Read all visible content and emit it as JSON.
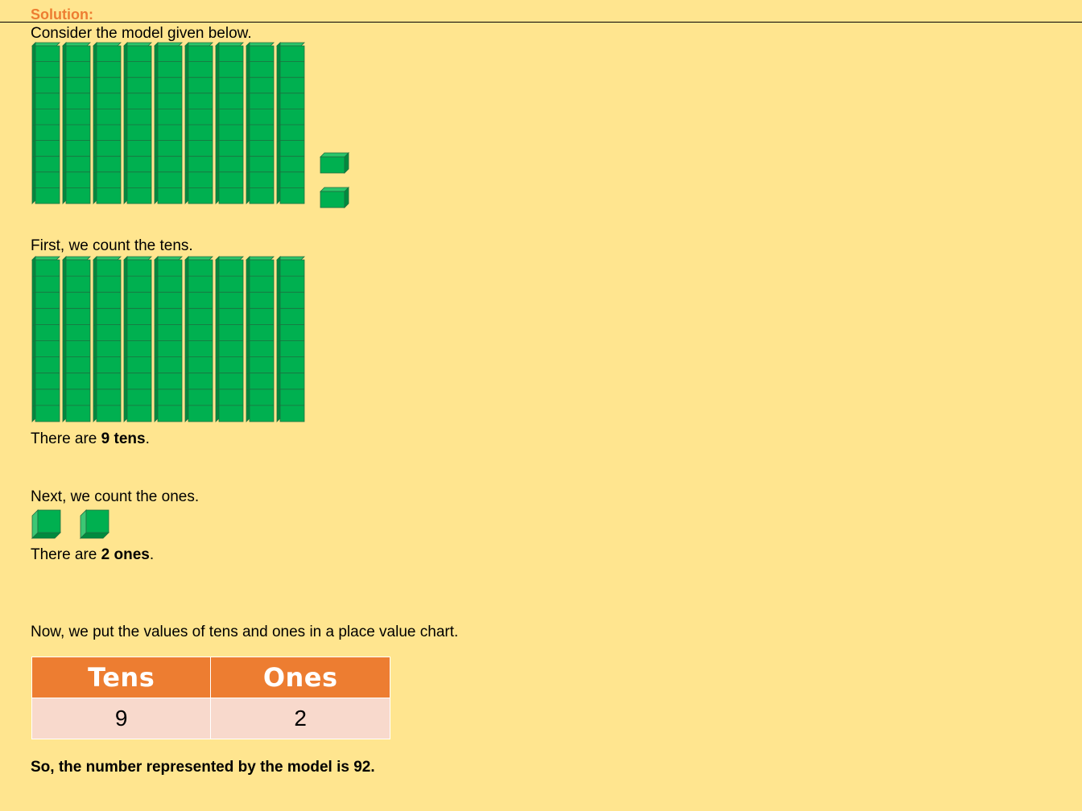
{
  "heading": "Solution:",
  "line1": "Consider the model given below.",
  "line2": "First, we count the tens.",
  "tens_line": {
    "prefix": "There are ",
    "bold": "9 tens",
    "suffix": "."
  },
  "line3": "Next, we count the ones.",
  "ones_line": {
    "prefix": "There are ",
    "bold": "2 ones",
    "suffix": "."
  },
  "line4": "Now, we put the values of tens and ones in a place value chart.",
  "table": {
    "headers": [
      "Tens",
      "Ones"
    ],
    "values": [
      "9",
      "2"
    ]
  },
  "conclusion": "So, the number represented by the model is 92.",
  "model": {
    "tens_rods": 9,
    "ones_cubes": 2
  },
  "colors": {
    "background": "#FFE58F",
    "accent": "#ED7D31",
    "block": "#00B050",
    "table_cell": "#F8D9CC"
  }
}
